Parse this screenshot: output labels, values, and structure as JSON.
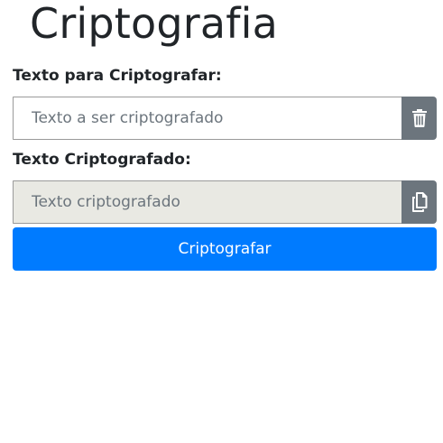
{
  "page": {
    "title": "Criptografia"
  },
  "encrypt_form": {
    "input_label": "Texto para Criptografar:",
    "input_placeholder": "Texto a ser criptografado",
    "input_value": "",
    "clear_icon": "trash-icon"
  },
  "result": {
    "output_label": "Texto Criptografado:",
    "output_placeholder": "Texto criptografado",
    "output_value": "",
    "copy_icon": "copy-icon"
  },
  "actions": {
    "encrypt_label": "Criptografar"
  },
  "colors": {
    "primary": "#007bff",
    "secondary": "#6c757d",
    "readonly_bg": "#e9e9e3"
  }
}
